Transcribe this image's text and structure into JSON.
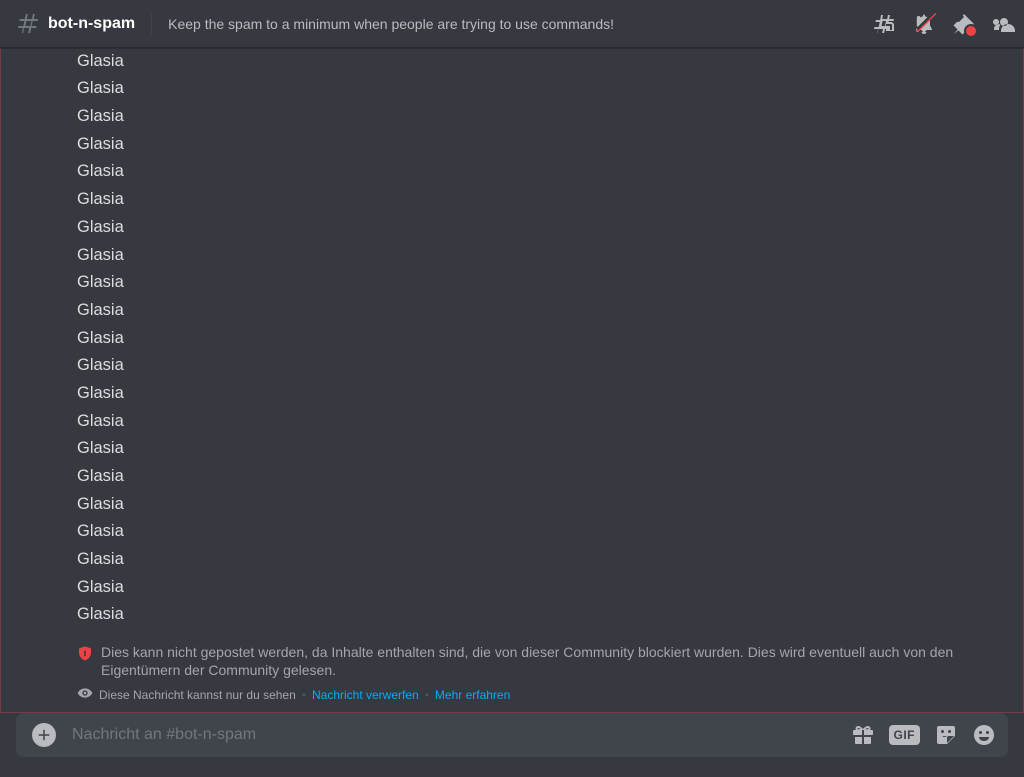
{
  "header": {
    "channel_name": "bot-n-spam",
    "topic": "Keep the spam to a minimum when people are trying to use commands!"
  },
  "messages": {
    "repeated_text": "Glasia",
    "lines": [
      "Glasia",
      "Glasia",
      "Glasia",
      "Glasia",
      "Glasia",
      "Glasia",
      "Glasia",
      "Glasia",
      "Glasia",
      "Glasia",
      "Glasia",
      "Glasia",
      "Glasia",
      "Glasia",
      "Glasia",
      "Glasia",
      "Glasia",
      "Glasia",
      "Glasia",
      "Glasia",
      "Glasia"
    ]
  },
  "block_notice": {
    "text": "Dies kann nicht gepostet werden, da Inhalte enthalten sind, die von dieser Community blockiert wurden. Dies wird eventuell auch von den Eigentümern der Community gelesen."
  },
  "ephemeral_notice": {
    "prefix": "Diese Nachricht kannst nur du sehen",
    "dismiss": "Nachricht verwerfen",
    "learn_more": "Mehr erfahren"
  },
  "input": {
    "placeholder": "Nachricht an #bot-n-spam",
    "gif_label": "GIF"
  }
}
